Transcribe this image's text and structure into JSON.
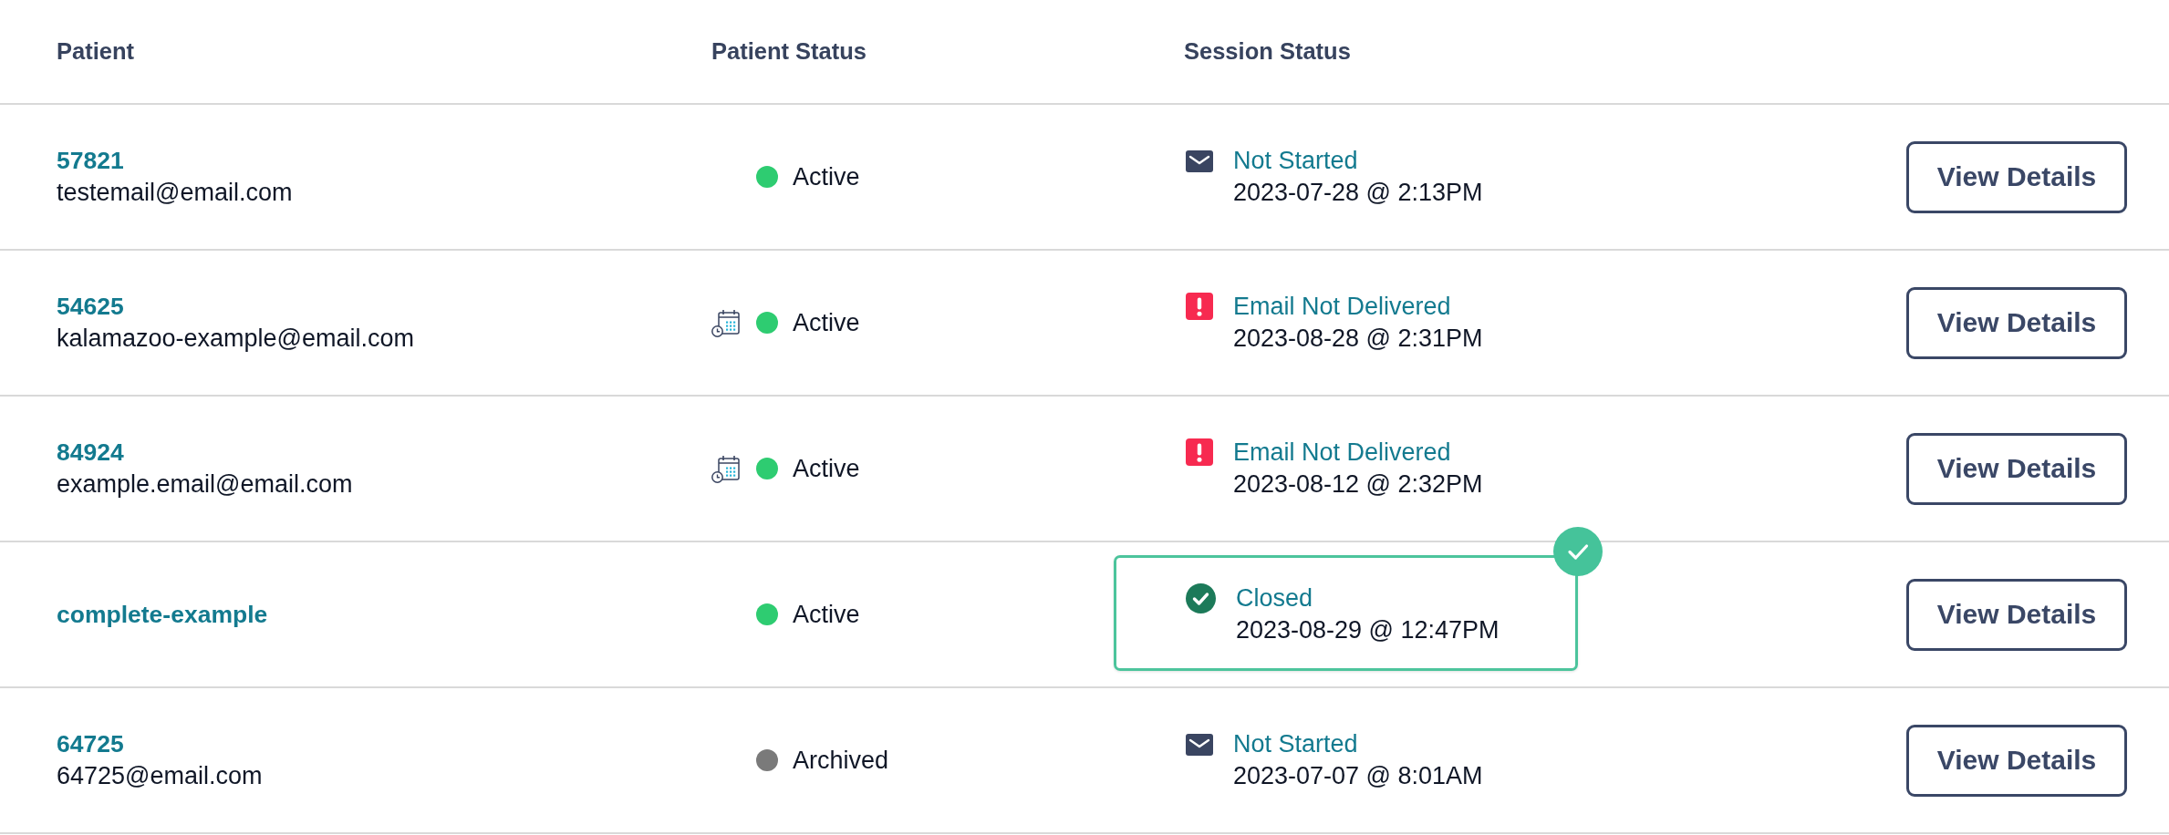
{
  "table": {
    "columns": [
      "Patient",
      "Patient Status",
      "Session Status"
    ],
    "rows": [
      {
        "patient": {
          "id": "57821",
          "email": "testemail@email.com"
        },
        "patient_status": {
          "label": "Active",
          "color": "#2ecc71",
          "scheduled": false
        },
        "session_status": {
          "kind": "mail",
          "label": "Not Started",
          "time": "2023-07-28 @ 2:13PM",
          "highlighted": false
        },
        "action": "View Details"
      },
      {
        "patient": {
          "id": "54625",
          "email": "kalamazoo-example@email.com"
        },
        "patient_status": {
          "label": "Active",
          "color": "#2ecc71",
          "scheduled": true
        },
        "session_status": {
          "kind": "alert",
          "label": "Email Not Delivered",
          "time": "2023-08-28 @ 2:31PM",
          "highlighted": false
        },
        "action": "View Details"
      },
      {
        "patient": {
          "id": "84924",
          "email": "example.email@email.com"
        },
        "patient_status": {
          "label": "Active",
          "color": "#2ecc71",
          "scheduled": true
        },
        "session_status": {
          "kind": "alert",
          "label": "Email Not Delivered",
          "time": "2023-08-12 @ 2:32PM",
          "highlighted": false
        },
        "action": "View Details"
      },
      {
        "patient": {
          "id": "complete-example"
        },
        "patient_status": {
          "label": "Active",
          "color": "#2ecc71",
          "scheduled": false
        },
        "session_status": {
          "kind": "closed",
          "label": "Closed",
          "time": "2023-08-29 @ 12:47PM",
          "highlighted": true
        },
        "action": "View Details"
      },
      {
        "patient": {
          "id": "64725",
          "email": "64725@email.com"
        },
        "patient_status": {
          "label": "Archived",
          "color": "#7a7a7a",
          "scheduled": false
        },
        "session_status": {
          "kind": "mail",
          "label": "Not Started",
          "time": "2023-07-07 @ 8:01AM",
          "highlighted": false
        },
        "action": "View Details"
      }
    ]
  }
}
